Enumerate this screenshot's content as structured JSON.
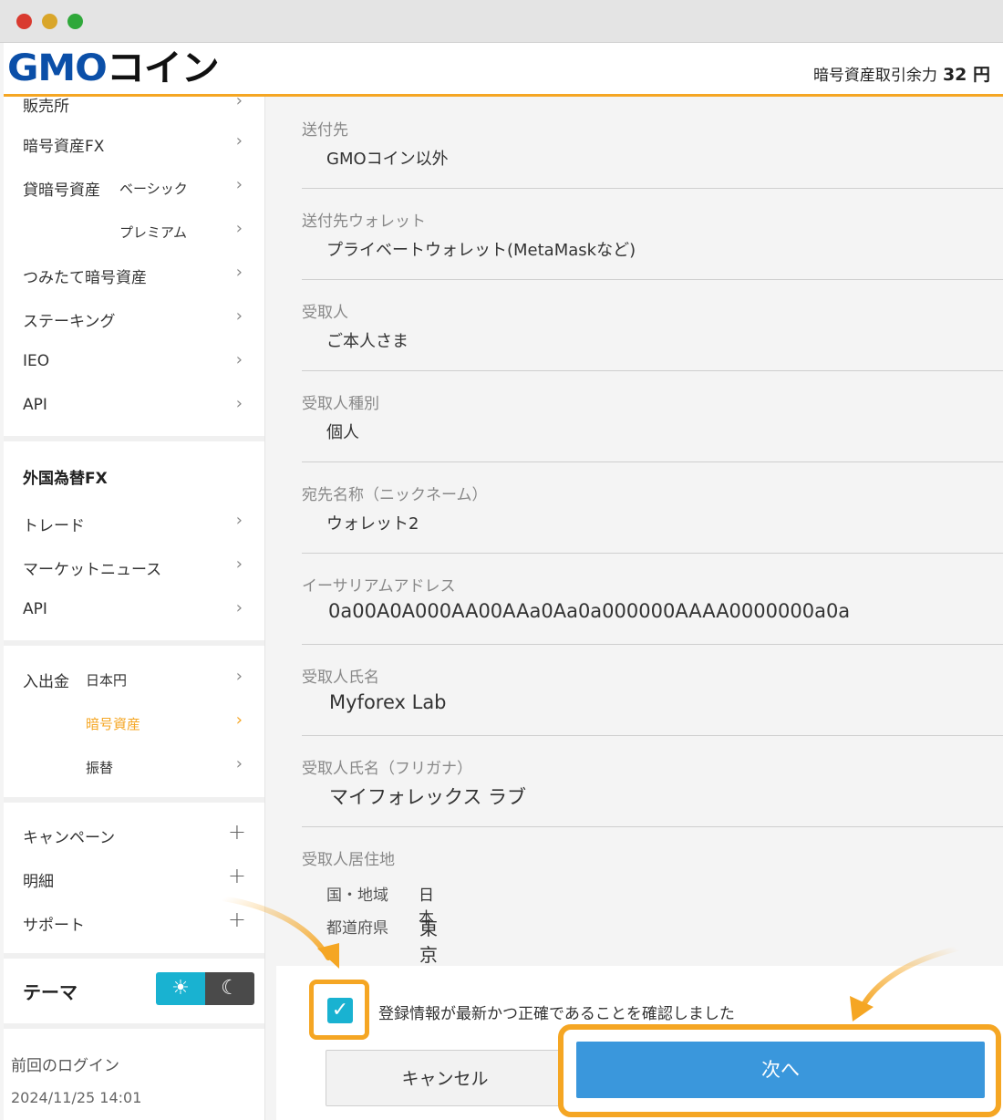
{
  "header": {
    "logo_latin": "GMO",
    "logo_kana": "コイン",
    "balance_label": "暗号資産取引余力",
    "balance_value": "32 円"
  },
  "sidebar": {
    "cut_item": "販売所",
    "crypto_items": [
      {
        "label": "暗号資産FX"
      },
      {
        "label": "貸暗号資産",
        "sub": "ベーシック"
      },
      {
        "sub": "プレミアム"
      },
      {
        "label": "つみたて暗号資産"
      },
      {
        "label": "ステーキング"
      },
      {
        "label": "IEO"
      },
      {
        "label": "API"
      }
    ],
    "fx_heading": "外国為替FX",
    "fx_items": [
      "トレード",
      "マーケットニュース",
      "API"
    ],
    "deposit_label": "入出金",
    "deposit_subs": [
      "日本円",
      "暗号資産",
      "振替"
    ],
    "expand_items": [
      "キャンペーン",
      "明細",
      "サポート"
    ],
    "theme_label": "テーマ",
    "last_login_label": "前回のログイン",
    "last_login_value": "2024/11/25 14:01",
    "active_color": "#f5a623"
  },
  "form": {
    "fields": [
      {
        "label": "送付先",
        "value": "GMOコイン以外"
      },
      {
        "label": "送付先ウォレット",
        "value": "プライベートウォレット(MetaMaskなど)"
      },
      {
        "label": "受取人",
        "value": "ご本人さま"
      },
      {
        "label": "受取人種別",
        "value": "個人"
      },
      {
        "label": "宛先名称（ニックネーム）",
        "value": "ウォレット2"
      },
      {
        "label": "イーサリアムアドレス",
        "value": "0a00A0A000AA00AAa0Aa0a000000AAAA0000000a0a"
      },
      {
        "label": "受取人氏名",
        "value": "Myforex Lab"
      },
      {
        "label": "受取人氏名（フリガナ）",
        "value": "マイフォレックス ラブ"
      }
    ],
    "address": {
      "label": "受取人居住地",
      "country_label": "国・地域",
      "country_value": "日本",
      "pref_label": "都道府県",
      "pref_value": "東京都"
    },
    "confirm_text": "登録情報が最新かつ正確であることを確認しました",
    "confirm_checked": true,
    "cancel_label": "キャンセル",
    "next_label": "次へ",
    "primary_color": "#3a97dc",
    "highlight_color": "#f5a623"
  }
}
